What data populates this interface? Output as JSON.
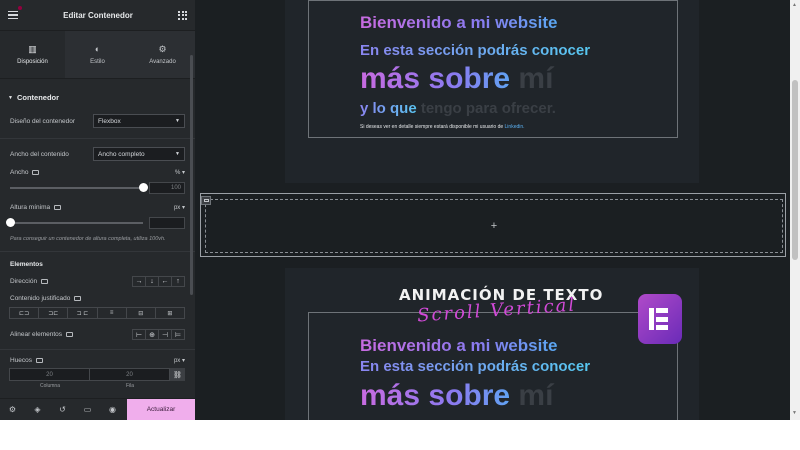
{
  "panel": {
    "title": "Editar Contenedor",
    "tabs": [
      {
        "label": "Disposición",
        "icon": "layout-icon",
        "active": true
      },
      {
        "label": "Estilo",
        "icon": "style-icon",
        "active": false
      },
      {
        "label": "Avanzado",
        "icon": "gear-icon",
        "active": false
      }
    ],
    "section": "Contenedor",
    "container_layout": {
      "label": "Diseño del contenedor",
      "value": "Flexbox"
    },
    "content_width": {
      "label": "Ancho del contenido",
      "value": "Ancho completo"
    },
    "width": {
      "label": "Ancho",
      "unit": "%",
      "placeholder": "100",
      "slider_level": 1.0
    },
    "min_height": {
      "label": "Altura mínima",
      "unit": "px",
      "slider_level": 0.0
    },
    "hint": "Para conseguir un contenedor de altura completa, utiliza 100vh.",
    "elements_heading": "Elementos",
    "direction": {
      "label": "Dirección",
      "options": [
        "→",
        "↓",
        "←",
        "↑"
      ]
    },
    "justify": {
      "label": "Contenido justificado",
      "options": [
        "⊏⊐",
        "⊐⊏",
        "⊐ ⊏",
        "≡",
        "⊟",
        "⊞"
      ]
    },
    "align": {
      "label": "Alinear elementos",
      "options": [
        "⊢",
        "⊕",
        "⊣",
        "⊨"
      ]
    },
    "gaps": {
      "label": "Huecos",
      "unit": "px",
      "column": "20",
      "row": "20",
      "column_label": "Columna",
      "row_label": "Fila"
    },
    "footer": {
      "update_label": "Actualizar"
    }
  },
  "canvas": {
    "top_card": {
      "line1": "Bienvenido a mi website",
      "line2": "En esta sección podrás conocer",
      "line3_main": "más sobre ",
      "line3_ghost": "mí",
      "line4_main": "y lo que ",
      "line4_ghost": "tengo para ofrecer.",
      "fine_print": "Si deseas ver en detalle siempre estará disponible mi usuario de ",
      "fine_print_link": "Linkedin."
    },
    "empty_section_plus": "+",
    "bottom_card": {
      "headline": "ANIMACIÓN DE TEXTO",
      "script": "Scroll Vertical",
      "line1": "Bienvenido a mi website",
      "line2": "En esta sección podrás conocer",
      "line3_main": "más sobre ",
      "line3_ghost": "mí"
    }
  },
  "colors": {
    "update_button": "#f0aeec",
    "gradient_start": "#c86be0",
    "gradient_end": "#5aa8f2",
    "logo": "#b04ac9"
  }
}
